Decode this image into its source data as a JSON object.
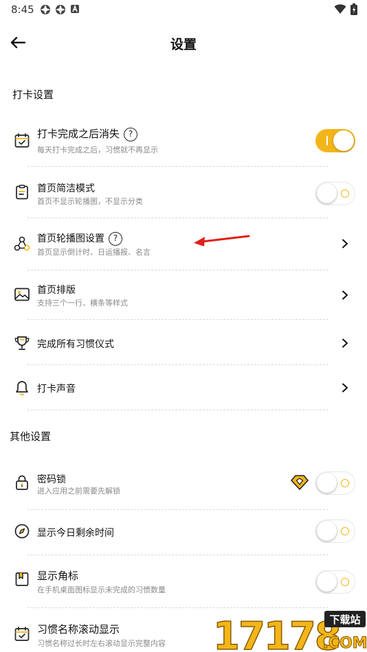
{
  "status": {
    "time": "8:45"
  },
  "header": {
    "title": "设置"
  },
  "sections": [
    {
      "title": "打卡设置"
    },
    {
      "title": "其他设置"
    }
  ],
  "rows": [
    {
      "title": "打卡完成之后消失",
      "subtitle": "每天打卡完成之后，习惯就不再显示",
      "help": "?",
      "toggle": true
    },
    {
      "title": "首页简洁模式",
      "subtitle": "首页不显示轮播图，不显示分类",
      "toggle": false
    },
    {
      "title": "首页轮播图设置",
      "subtitle": "首页显示倒计时、日运播报、名言",
      "help": "?"
    },
    {
      "title": "首页排版",
      "subtitle": "支持三个一行、横条等样式"
    },
    {
      "title": "完成所有习惯仪式"
    },
    {
      "title": "打卡声音"
    },
    {
      "title": "密码锁",
      "subtitle": "进入应用之前需要先解锁",
      "toggle": false
    },
    {
      "title": "显示今日剩余时间",
      "toggle": false
    },
    {
      "title": "显示角标",
      "subtitle": "在手机桌面图标显示未完成的习惯数量",
      "toggle": false
    },
    {
      "title": "习惯名称滚动显示",
      "subtitle": "习惯名称过长时左右滚动显示完整内容"
    }
  ],
  "watermark": {
    "number": "17178",
    "badge": "下载站",
    "domain": ".COM"
  },
  "colors": {
    "accent": "#f2b61a",
    "annotation_arrow": "#e0201a"
  }
}
